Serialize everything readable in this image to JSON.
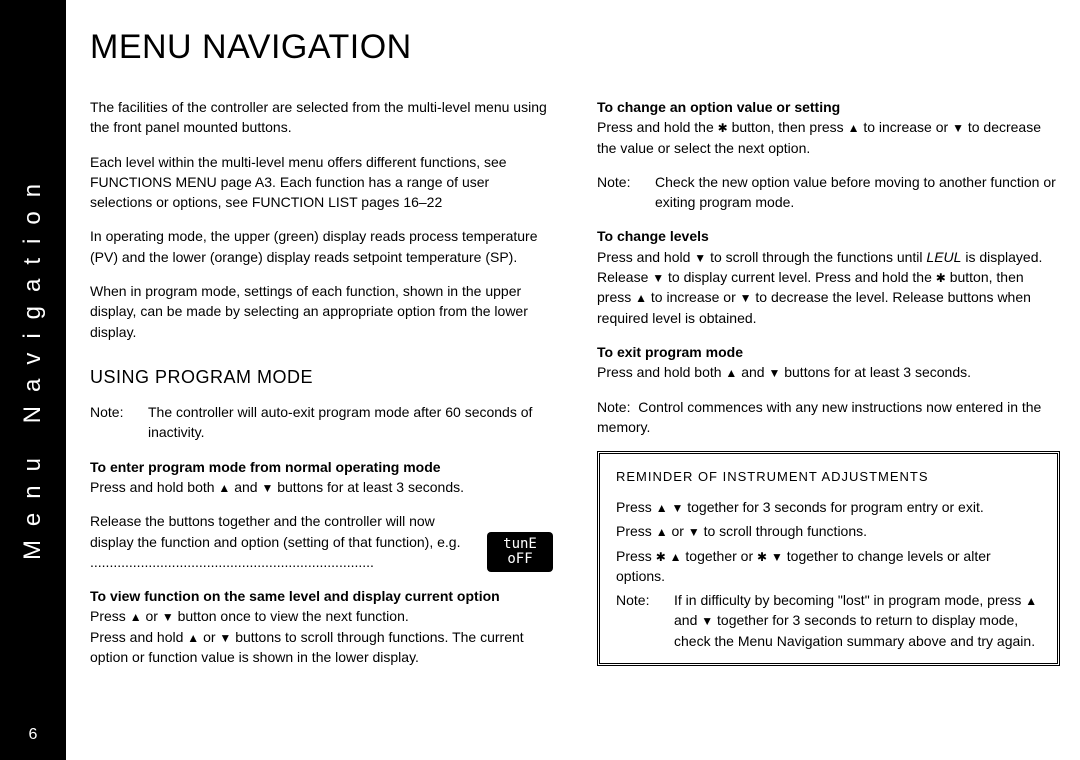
{
  "sidebar": {
    "label": "Menu Navigation",
    "page": "6"
  },
  "heading": "MENU NAVIGATION",
  "left": {
    "intro1": "The facilities of the controller are selected from the multi-level menu using the front panel mounted buttons.",
    "intro2": "Each level within the multi-level menu offers different functions, see FUNCTIONS MENU page A3. Each function has a range of user selections or options, see FUNCTION LIST pages 16–22",
    "intro3": "In operating mode, the upper (green) display reads process temperature (PV) and the lower (orange) display reads setpoint temperature (SP).",
    "intro4": "When in program mode, settings of each function, shown in the upper display, can be made by selecting an appropriate option from the lower display.",
    "h2": "USING PROGRAM MODE",
    "noteLabel": "Note:",
    "noteBody": "The controller will auto-exit program mode after 60 seconds of inactivity.",
    "enterHead": "To enter program mode from normal operating mode",
    "enterBodyA": "Press and hold both ",
    "enterBodyB": " and ",
    "enterBodyC": " buttons for at least 3 seconds.",
    "release": "Release the buttons together and the controller will now display the function and option (setting of that function), e.g. .........................................................................",
    "tune1": "tunE",
    "tune2": "oFF",
    "viewHead": "To view function on the same level and display current option",
    "viewA": "Press ",
    "viewB": " or ",
    "viewC": " button once to view the next function.",
    "viewD": "Press and hold ",
    "viewE": " or ",
    "viewF": " buttons to scroll through functions. The current option or function value is shown in the lower display."
  },
  "right": {
    "changeHead": "To change an option value or setting",
    "changeA": "Press and hold the ",
    "changeB": " button, then press ",
    "changeC": " to increase or ",
    "changeD": " to decrease the value or select the next option.",
    "note1Label": "Note:",
    "note1Body": "Check the new option value before moving to another function or exiting program mode.",
    "levelsHead": "To change levels",
    "levelsA": "Press and hold ",
    "levelsB": " to scroll through the functions until ",
    "levelsCode": "LEUL",
    "levelsC": " is displayed. Release ",
    "levelsD": " to display current level. Press and hold the ",
    "levelsE": " button, then press ",
    "levelsF": " to increase or ",
    "levelsG": " to decrease the level. Release buttons when required level is obtained.",
    "exitHead": "To exit program mode",
    "exitA": "Press and hold both ",
    "exitB": " and ",
    "exitC": " buttons for at least 3 seconds.",
    "note2a": "Note:",
    "note2b": "Control commences with any new instructions now entered in the memory.",
    "reminder": {
      "title": "REMINDER OF INSTRUMENT ADJUSTMENTS",
      "l1a": "Press ",
      "l1b": " ",
      "l1c": " together for 3 seconds for program entry or exit.",
      "l2a": "Press ",
      "l2b": " or ",
      "l2c": " to scroll through functions.",
      "l3a": "Press ",
      "l3b": " ",
      "l3c": " together or ",
      "l3d": " ",
      "l3e": " together to change levels or alter options.",
      "noteLabel": "Note:",
      "noteBody1": "If in difficulty by becoming \"lost\" in program mode, press ",
      "noteBody2": " and ",
      "noteBody3": " together for 3 seconds to return to display mode, check the Menu Navigation summary above and try again."
    }
  },
  "glyph": {
    "up": "▲",
    "down": "▼",
    "star": "✱"
  }
}
